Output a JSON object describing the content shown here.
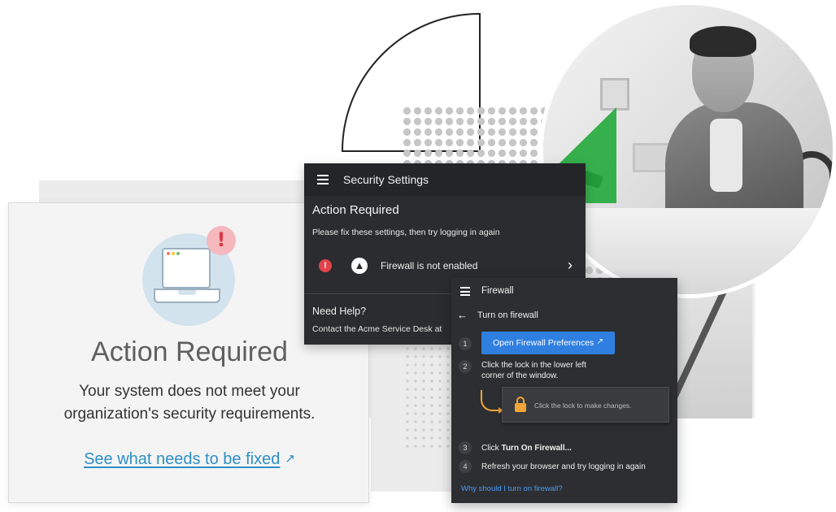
{
  "card": {
    "title": "Action Required",
    "description": "Your system does not meet your organization's security requirements.",
    "link_label": "See what needs to be fixed",
    "badge_symbol": "!",
    "icon": "laptop-icon"
  },
  "security_panel": {
    "title": "Security Settings",
    "heading": "Action Required",
    "subtitle": "Please fix these settings, then try logging in again",
    "item": {
      "label": "Firewall is not enabled",
      "status_symbol": "!",
      "icon": "flame-icon"
    },
    "help_title": "Need Help?",
    "help_text": "Contact the Acme Service Desk at"
  },
  "firewall_panel": {
    "title": "Firewall",
    "subtitle": "Turn on firewall",
    "steps": [
      {
        "num": "1",
        "button_label": "Open Firewall Preferences"
      },
      {
        "num": "2",
        "line1": "Click the lock in the lower left",
        "line2": "corner of the window."
      },
      {
        "num": "3",
        "text_prefix": "Click ",
        "text_bold": "Turn On Firewall..."
      },
      {
        "num": "4",
        "text": "Refresh your browser and try logging in again"
      }
    ],
    "lock_hint": "Click the lock to make changes.",
    "help_link": "Why should I turn on firewall?"
  },
  "colors": {
    "accent_blue": "#2f7fe0",
    "link_blue": "#2d8fc6",
    "alert_red": "#e2434b",
    "lock_orange": "#f0a53a",
    "panel_dark": "#2b2c2f",
    "decor_green": "#22aa3c"
  }
}
